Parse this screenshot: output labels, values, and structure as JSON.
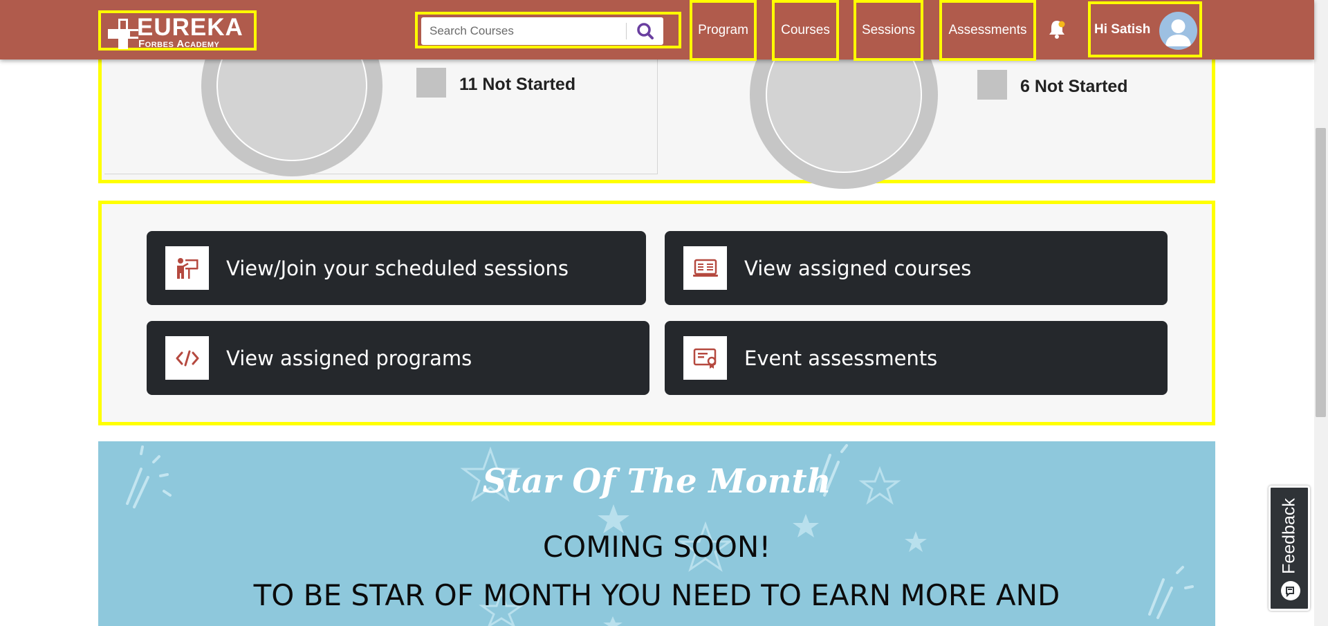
{
  "header": {
    "logo": {
      "title": "EUREKA",
      "subtitle": "Forbes Academy"
    },
    "search": {
      "placeholder": "Search Courses"
    },
    "nav": {
      "program": "Program",
      "courses": "Courses",
      "sessions": "Sessions",
      "assessments": "Assessments"
    },
    "user": {
      "greeting": "Hi Satish"
    }
  },
  "progress": {
    "left": {
      "not_started": "11 Not Started"
    },
    "right": {
      "not_started": "6 Not Started"
    }
  },
  "quick_links": {
    "sessions": {
      "label": "View/Join your scheduled sessions",
      "icon": "presenter-icon"
    },
    "courses": {
      "label": "View assigned courses",
      "icon": "laptop-course-icon"
    },
    "programs": {
      "label": "View assigned programs",
      "icon": "code-icon"
    },
    "assessments": {
      "label": "Event assessments",
      "icon": "certificate-icon"
    }
  },
  "star_banner": {
    "title": "Star Of The Month",
    "coming_soon": "COMING SOON!",
    "message": "TO BE STAR OF MONTH YOU NEED TO EARN MORE AND"
  },
  "feedback": {
    "label": "Feedback"
  },
  "colors": {
    "header": "#b05b4c",
    "highlight": "#ffff00",
    "quick_link_bg": "#25282c",
    "icon_accent": "#b5493f",
    "banner": "#8ec8dc",
    "search_icon": "#6a3fa0"
  }
}
